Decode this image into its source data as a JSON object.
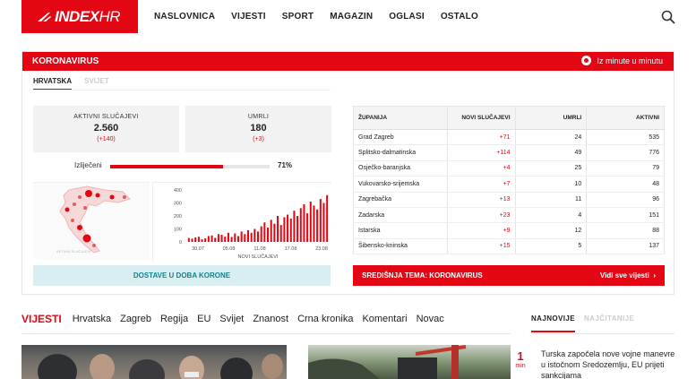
{
  "header": {
    "logo_text_a": "INDEX",
    "logo_text_b": "HR",
    "nav": [
      "NASLOVNICA",
      "VIJESTI",
      "SPORT",
      "MAGAZIN",
      "OGLASI",
      "OSTALO"
    ]
  },
  "corona": {
    "title": "KORONAVIRUS",
    "live_label": "Iz minute u minutu",
    "tabs": [
      "HRVATSKA",
      "SVIJET"
    ],
    "active_label": "AKTIVNI SLUČAJEVI",
    "active_value": "2.560",
    "active_delta": "(+140)",
    "deaths_label": "UMRLI",
    "deaths_value": "180",
    "deaths_delta": "(+3)",
    "recovered_label": "Izliječeni",
    "recovered_pct": "71%",
    "recovered_fraction": 0.71,
    "map_label": "AKTIVNI SLUČAJEVI",
    "button_dostave": "DOSTAVE U DOBA KORONE",
    "button_tema": "SREDIŠNJA TEMA: KORONAVIRUS",
    "button_tema_more": "Vidi sve vijesti",
    "table": {
      "headers": [
        "ŽUPANIJA",
        "NOVI SLUČAJEVI",
        "UMRLI",
        "AKTIVNI"
      ],
      "rows": [
        [
          "Grad Zagreb",
          "+71",
          "24",
          "535"
        ],
        [
          "Splitsko-dalmatinska",
          "+114",
          "49",
          "776"
        ],
        [
          "Osječko-baranjska",
          "+4",
          "25",
          "79"
        ],
        [
          "Vukovarsko-srijemska",
          "+7",
          "10",
          "48"
        ],
        [
          "Zagrebačka",
          "+13",
          "11",
          "96"
        ],
        [
          "Zadarska",
          "+23",
          "4",
          "151"
        ],
        [
          "Istarska",
          "+9",
          "12",
          "88"
        ],
        [
          "Šibensko-kninska",
          "+15",
          "5",
          "137"
        ]
      ]
    }
  },
  "chart_data": {
    "type": "bar",
    "xlabel": "NOVI SLUČAJEVI",
    "ylim": [
      0,
      400
    ],
    "yticks": [
      "400",
      "300",
      "200",
      "100",
      "0"
    ],
    "xticks": [
      "30.07",
      "05.08",
      "11.08",
      "17.08",
      "23.08"
    ],
    "values": [
      30,
      25,
      35,
      40,
      20,
      28,
      45,
      50,
      32,
      60,
      55,
      40,
      70,
      38,
      65,
      45,
      80,
      60,
      90,
      70,
      100,
      80,
      120,
      150,
      110,
      170,
      140,
      200,
      130,
      190,
      210,
      180,
      240,
      200,
      260,
      290,
      220,
      310,
      280,
      250,
      330,
      300,
      360
    ],
    "color": "#e30613"
  },
  "subnav": {
    "brand": "VIJESTI",
    "items": [
      "Hrvatska",
      "Zagreb",
      "Regija",
      "EU",
      "Svijet",
      "Znanost",
      "Crna kronika",
      "Komentari",
      "Novac"
    ],
    "side_tabs": [
      "NAJNOVIJE",
      "NAJČITANIJE"
    ]
  },
  "news": {
    "time_num": "1",
    "time_unit": "min",
    "headline": "Turska započela nove vojne manevre u istočnom Sredozemlju, EU prijeti sankcijama"
  }
}
